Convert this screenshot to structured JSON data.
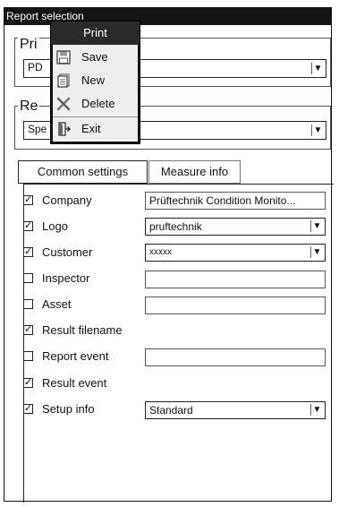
{
  "window": {
    "title": "Report selection"
  },
  "printer_group": {
    "legend": "Pri",
    "value": "PD"
  },
  "report_group": {
    "legend": "Re",
    "value": "Spe"
  },
  "popup_menu": {
    "title": "Print",
    "items": [
      {
        "label": "Save",
        "icon": "save-icon"
      },
      {
        "label": "New",
        "icon": "new-document-icon"
      },
      {
        "label": "Delete",
        "icon": "delete-x-icon"
      },
      {
        "label": "Exit",
        "icon": "exit-door-icon"
      }
    ]
  },
  "tabs": [
    {
      "label": "Common settings",
      "active": true
    },
    {
      "label": "Measure info",
      "active": false
    }
  ],
  "settings": [
    {
      "label": "Company",
      "checked": true,
      "value": "Prüftechnik Condition Monito...",
      "type": "text"
    },
    {
      "label": "Logo",
      "checked": true,
      "value": "pruftechnik",
      "type": "combo"
    },
    {
      "label": "Customer",
      "checked": true,
      "value": "xxxxx",
      "type": "combo"
    },
    {
      "label": "Inspector",
      "checked": false,
      "value": "",
      "type": "text"
    },
    {
      "label": "Asset",
      "checked": false,
      "value": "",
      "type": "text"
    },
    {
      "label": "Result filename",
      "checked": true,
      "value": "",
      "type": "none"
    },
    {
      "label": "Report event",
      "checked": false,
      "value": "",
      "type": "text"
    },
    {
      "label": "Result event",
      "checked": true,
      "value": "",
      "type": "none"
    },
    {
      "label": "Setup info",
      "checked": true,
      "value": "Standard",
      "type": "combo"
    }
  ],
  "glyphs": {
    "checked": "✓",
    "dropdown": "▼"
  }
}
